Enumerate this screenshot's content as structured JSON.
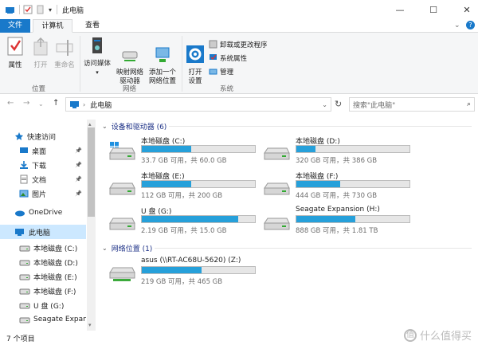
{
  "window": {
    "title": "此电脑"
  },
  "tabs": {
    "file": "文件",
    "computer": "计算机",
    "view": "查看"
  },
  "ribbon": {
    "location": {
      "label": "位置",
      "properties": "属性",
      "open": "打开",
      "rename": "重命名"
    },
    "network": {
      "label": "网络",
      "media": "访问媒体",
      "map_drive": "映射网络\n驱动器",
      "add_location": "添加一个\n网络位置"
    },
    "system": {
      "label": "系统",
      "open_settings": "打开\n设置",
      "uninstall": "卸载或更改程序",
      "sys_props": "系统属性",
      "manage": "管理"
    }
  },
  "address": {
    "path": "此电脑",
    "search_placeholder": "搜索\"此电脑\""
  },
  "nav": {
    "items": [
      {
        "label": "快速访问",
        "kind": "star"
      },
      {
        "label": "桌面",
        "kind": "desktop",
        "pinned": true
      },
      {
        "label": "下载",
        "kind": "download",
        "pinned": true
      },
      {
        "label": "文档",
        "kind": "doc",
        "pinned": true
      },
      {
        "label": "图片",
        "kind": "pic",
        "pinned": true
      },
      {
        "label": "OneDrive",
        "kind": "cloud"
      },
      {
        "label": "此电脑",
        "kind": "pc",
        "selected": true
      },
      {
        "label": "本地磁盘 (C:)",
        "kind": "disk"
      },
      {
        "label": "本地磁盘 (D:)",
        "kind": "disk"
      },
      {
        "label": "本地磁盘 (E:)",
        "kind": "disk"
      },
      {
        "label": "本地磁盘 (F:)",
        "kind": "disk"
      },
      {
        "label": "U 盘 (G:)",
        "kind": "disk"
      },
      {
        "label": "Seagate Expansion",
        "kind": "disk"
      }
    ]
  },
  "groups": {
    "devices": "设备和驱动器 (6)",
    "network": "网络位置 (1)"
  },
  "drives": [
    {
      "name": "本地磁盘 (C:)",
      "size": "33.7 GB 可用，共 60.0 GB",
      "used": 0.44,
      "windows": true
    },
    {
      "name": "本地磁盘 (D:)",
      "size": "320 GB 可用，共 386 GB",
      "used": 0.17
    },
    {
      "name": "本地磁盘 (E:)",
      "size": "112 GB 可用，共 200 GB",
      "used": 0.44
    },
    {
      "name": "本地磁盘 (F:)",
      "size": "444 GB 可用，共 730 GB",
      "used": 0.39
    },
    {
      "name": "U 盘 (G:)",
      "size": "2.19 GB 可用，共 15.0 GB",
      "used": 0.85
    },
    {
      "name": "Seagate Expansion (H:)",
      "size": "888 GB 可用，共 1.81 TB",
      "used": 0.52
    }
  ],
  "network_drive": {
    "name": "asus (\\\\RT-AC68U-5620) (Z:)",
    "size": "219 GB 可用，共 465 GB",
    "used": 0.53
  },
  "status": {
    "count": "7 个项目"
  },
  "watermark": {
    "text": "什么值得买"
  },
  "colors": {
    "accent": "#1979ca",
    "bar_fill": "#26a0da",
    "selected": "#cce8ff",
    "group_title": "#1e3287"
  }
}
